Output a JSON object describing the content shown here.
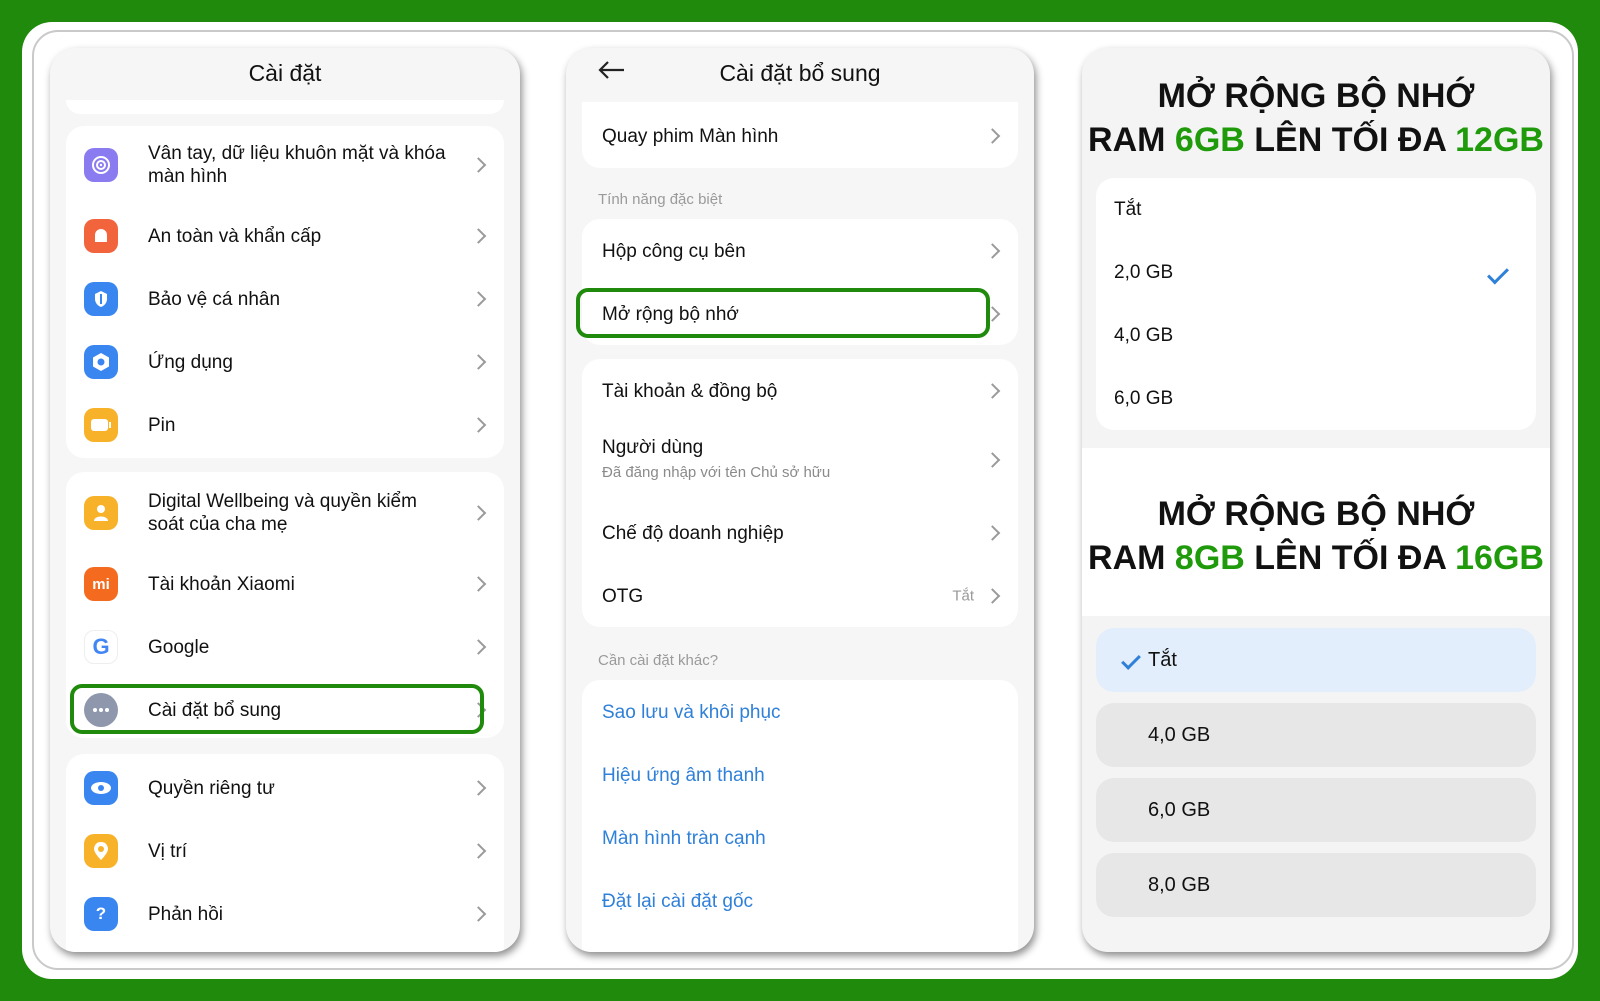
{
  "panel1": {
    "title": "Cài đặt",
    "items": [
      {
        "label": "Vân tay, dữ liệu khuôn mặt và khóa màn hình",
        "icon": "fingerprint-icon",
        "color": "#8a7cf0"
      },
      {
        "label": "An toàn và khẩn cấp",
        "icon": "emergency-icon",
        "color": "#f2643c"
      },
      {
        "label": "Bảo vệ cá nhân",
        "icon": "shield-icon",
        "color": "#3a86f0"
      },
      {
        "label": "Ứng dụng",
        "icon": "apps-gear-icon",
        "color": "#3a86f0"
      },
      {
        "label": "Pin",
        "icon": "battery-icon",
        "color": "#f7b22a"
      },
      {
        "label": "Digital Wellbeing và quyền kiểm soát của cha mẹ",
        "icon": "wellbeing-icon",
        "color": "#f7b22a"
      },
      {
        "label": "Tài khoản Xiaomi",
        "icon": "xiaomi-icon",
        "color": "#f46a1e",
        "glyph": "mi"
      },
      {
        "label": "Google",
        "icon": "google-icon",
        "color": "#ffffff",
        "glyph": "G"
      },
      {
        "label": "Cài đặt bổ sung",
        "icon": "more-dots-icon",
        "color": "#8e97ab"
      },
      {
        "label": "Quyền riêng tư",
        "icon": "eye-icon",
        "color": "#3a86f0"
      },
      {
        "label": "Vị trí",
        "icon": "location-pin-icon",
        "color": "#f7b22a"
      },
      {
        "label": "Phản hồi",
        "icon": "feedback-icon",
        "color": "#3a86f0",
        "glyph": "?"
      }
    ]
  },
  "panel2": {
    "title": "Cài đặt bổ sung",
    "top_item": "Quay phim Màn hình",
    "section1": "Tính năng đặc biệt",
    "special": [
      "Hộp công cụ bên",
      "Mở rộng bộ nhớ"
    ],
    "account_items": {
      "sync": "Tài khoản & đồng bộ",
      "user": "Người dùng",
      "user_sub": "Đã đăng nhập với tên Chủ sở hữu",
      "enterprise": "Chế độ doanh nghiệp",
      "otg": "OTG",
      "otg_value": "Tắt"
    },
    "section2": "Cần cài đặt khác?",
    "links": [
      "Sao lưu và khôi phục",
      "Hiệu ứng âm thanh",
      "Màn hình tràn cạnh",
      "Đặt lại cài đặt gốc"
    ]
  },
  "panel3": {
    "headline1": {
      "l1": "MỞ RỘNG BỘ NHỚ",
      "pre": "RAM ",
      "a": "6GB",
      "mid": " LÊN TỐI ĐA ",
      "b": "12GB"
    },
    "options1": [
      "Tắt",
      "2,0 GB",
      "4,0 GB",
      "6,0 GB"
    ],
    "selected1": "2,0 GB",
    "headline2": {
      "l1": "MỞ RỘNG BỘ NHỚ",
      "pre": "RAM ",
      "a": "8GB",
      "mid": " LÊN TỐI ĐA ",
      "b": "16GB"
    },
    "options2": [
      "Tắt",
      "4,0 GB",
      "6,0 GB",
      "8,0 GB"
    ],
    "selected2": "Tắt"
  },
  "colors": {
    "accent_green": "#1f8a0b",
    "link_blue": "#2f80d8"
  }
}
